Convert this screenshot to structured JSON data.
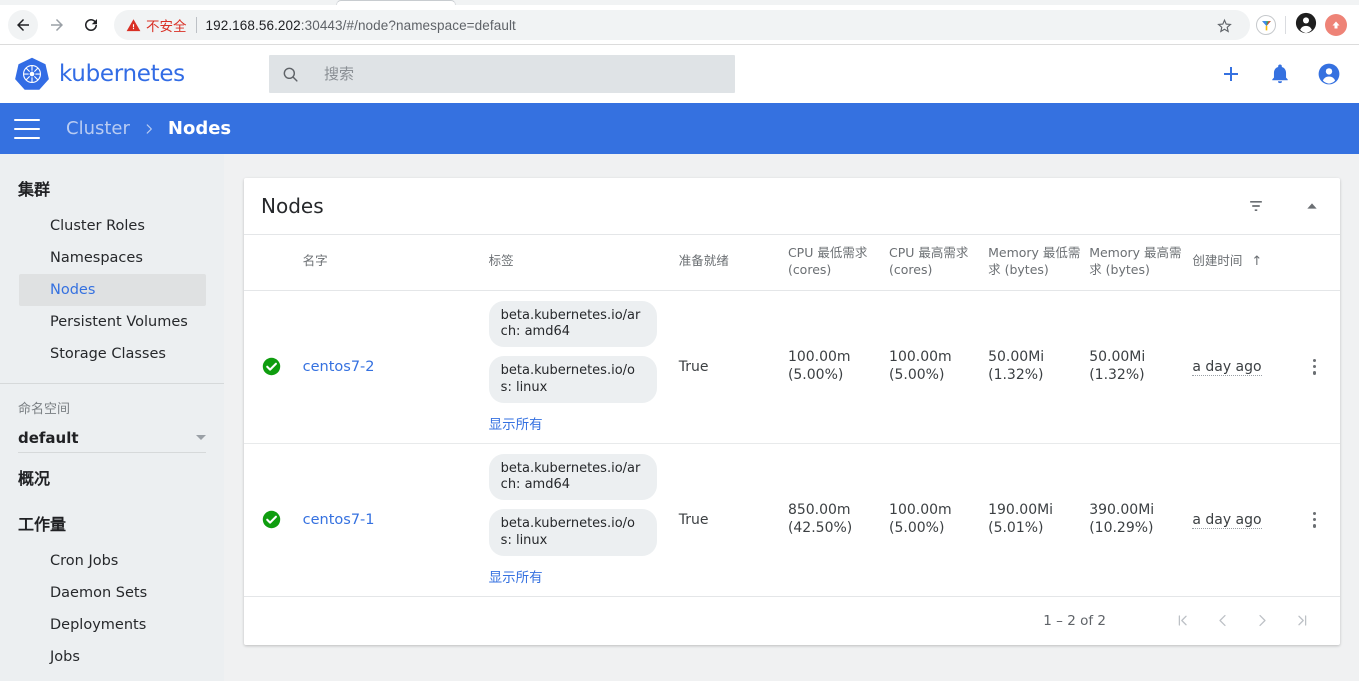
{
  "browser": {
    "back_icon": "arrow-left-icon",
    "forward_icon": "arrow-right-icon",
    "reload_icon": "reload-icon",
    "security_warning_icon": "warning-triangle-icon",
    "security_label": "不安全",
    "url_host": "192.168.56.202",
    "url_rest": ":30443/#/node?namespace=default",
    "bookmark_icon": "star-icon",
    "extension_icon": "extension-icon",
    "profile_icon": "profile-avatar-icon",
    "update_icon": "update-arrow-icon"
  },
  "header": {
    "logo_icon": "kubernetes-logo-icon",
    "brand": "kubernetes",
    "search": {
      "icon": "search-icon",
      "placeholder": "搜索",
      "value": ""
    },
    "actions": [
      {
        "name": "create-button",
        "icon": "plus-icon"
      },
      {
        "name": "notifications-button",
        "icon": "bell-icon"
      },
      {
        "name": "account-button",
        "icon": "account-circle-icon"
      }
    ]
  },
  "breadcrumb": {
    "menu_icon": "hamburger-menu-icon",
    "parent": "Cluster",
    "separator": "›",
    "current": "Nodes"
  },
  "sidebar": {
    "sections": [
      {
        "heading": "集群",
        "items": [
          {
            "label": "Cluster Roles",
            "active": false
          },
          {
            "label": "Namespaces",
            "active": false
          },
          {
            "label": "Nodes",
            "active": true
          },
          {
            "label": "Persistent Volumes",
            "active": false
          },
          {
            "label": "Storage Classes",
            "active": false
          }
        ]
      }
    ],
    "namespace": {
      "label": "命名空间",
      "value": "default",
      "caret_icon": "chevron-down-icon"
    },
    "overview_heading": "概况",
    "workload_heading": "工作量",
    "workload_items": [
      {
        "label": "Cron Jobs"
      },
      {
        "label": "Daemon Sets"
      },
      {
        "label": "Deployments"
      },
      {
        "label": "Jobs"
      }
    ]
  },
  "card": {
    "title": "Nodes",
    "filter_icon": "filter-list-icon",
    "collapse_icon": "chevron-up-icon",
    "columns": [
      {
        "key": "status",
        "label": ""
      },
      {
        "key": "name",
        "label": "名字"
      },
      {
        "key": "labels",
        "label": "标签"
      },
      {
        "key": "ready",
        "label": "准备就绪"
      },
      {
        "key": "cpu_min",
        "label": "CPU 最低需求 (cores)"
      },
      {
        "key": "cpu_max",
        "label": "CPU 最高需求 (cores)"
      },
      {
        "key": "mem_min",
        "label": "Memory 最低需求 (bytes)"
      },
      {
        "key": "mem_max",
        "label": "Memory 最高需求 (bytes)"
      },
      {
        "key": "created",
        "label": "创建时间",
        "sorted": "asc",
        "sort_icon": "arrow-up-icon"
      },
      {
        "key": "menu",
        "label": ""
      }
    ],
    "rows": [
      {
        "status_icon": "check-circle-icon",
        "status_color": "#0f9d0f",
        "name": "centos7-2",
        "labels": [
          "beta.kubernetes.io/arch: amd64",
          "beta.kubernetes.io/os: linux"
        ],
        "show_all": "显示所有",
        "ready": "True",
        "cpu_min": "100.00m",
        "cpu_min_pct": "(5.00%)",
        "cpu_max": "100.00m",
        "cpu_max_pct": "(5.00%)",
        "mem_min": "50.00Mi",
        "mem_min_pct": "(1.32%)",
        "mem_max": "50.00Mi",
        "mem_max_pct": "(1.32%)",
        "created": "a day ago",
        "menu_icon": "kebab-menu-icon"
      },
      {
        "status_icon": "check-circle-icon",
        "status_color": "#0f9d0f",
        "name": "centos7-1",
        "labels": [
          "beta.kubernetes.io/arch: amd64",
          "beta.kubernetes.io/os: linux"
        ],
        "show_all": "显示所有",
        "ready": "True",
        "cpu_min": "850.00m",
        "cpu_min_pct": "(42.50%)",
        "cpu_max": "100.00m",
        "cpu_max_pct": "(5.00%)",
        "mem_min": "190.00Mi",
        "mem_min_pct": "(5.01%)",
        "mem_max": "390.00Mi",
        "mem_max_pct": "(10.29%)",
        "created": "a day ago",
        "menu_icon": "kebab-menu-icon"
      }
    ],
    "pagination": {
      "range": "1 – 2 of 2",
      "first_icon": "first-page-icon",
      "prev_icon": "prev-page-icon",
      "next_icon": "next-page-icon",
      "last_icon": "last-page-icon"
    }
  },
  "colors": {
    "brand_blue": "#326ce5",
    "bar_blue": "#3571e0",
    "link_blue": "#3571e0",
    "status_green": "#0f9d0f",
    "insecure_red": "#d93025"
  }
}
